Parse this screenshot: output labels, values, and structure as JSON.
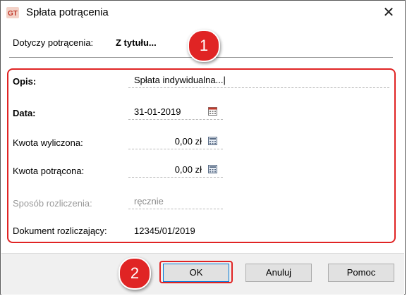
{
  "window": {
    "title": "Spłata potrącenia",
    "close_glyph": "✕"
  },
  "header": {
    "label": "Dotyczy potrącenia:",
    "value": "Z tytułu..."
  },
  "form": {
    "opis": {
      "label": "Opis:",
      "value": "Spłata indywidualna...|"
    },
    "data": {
      "label": "Data:",
      "value": "31-01-2019",
      "icon": "calendar-icon"
    },
    "kwota_wyliczona": {
      "label": "Kwota wyliczona:",
      "value": "0,00 zł",
      "icon": "calculator-icon"
    },
    "kwota_potracona": {
      "label": "Kwota potrącona:",
      "value": "0,00 zł",
      "icon": "calculator-icon"
    },
    "sposob_rozliczenia": {
      "label": "Sposób rozliczenia:",
      "value": "ręcznie"
    },
    "dokument": {
      "label": "Dokument rozliczający:",
      "value": "12345/01/2019"
    }
  },
  "badges": {
    "first": "1",
    "second": "2"
  },
  "buttons": {
    "ok": "OK",
    "cancel": "Anuluj",
    "help": "Pomoc"
  },
  "colors": {
    "highlight": "#e02424",
    "window_border": "#5a5a5a",
    "footer_bg": "#f0f0f0"
  }
}
